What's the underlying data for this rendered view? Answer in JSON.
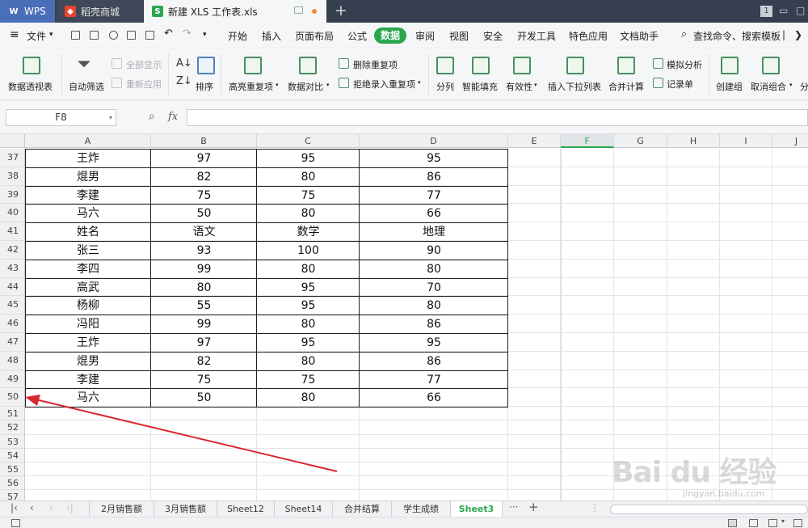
{
  "titlebar": {
    "tabs": [
      {
        "label": "WPS"
      },
      {
        "label": "稻壳商城"
      },
      {
        "label": "新建 XLS 工作表.xls"
      }
    ],
    "new_tab": "+",
    "window_badge": "1"
  },
  "menubar": {
    "file_label": "文件",
    "items": [
      "开始",
      "插入",
      "页面布局",
      "公式",
      "数据",
      "审阅",
      "视图",
      "安全",
      "开发工具",
      "特色应用",
      "文档助手"
    ],
    "active_item": "数据",
    "search_label": "查找命令、搜索模板"
  },
  "ribbon": {
    "pivot": "数据透视表",
    "auto_filter": "自动筛选",
    "show_all": "全部显示",
    "reapply": "重新应用",
    "sort": "排序",
    "highlight_dup": "高亮重复项",
    "remove_dup": "删除重复项",
    "reject_dup": "拒绝录入重复项",
    "compare": "数据对比",
    "split": "分列",
    "smart_fill": "智能填充",
    "validity": "有效性",
    "dropdown": "插入下拉列表",
    "consolidate": "合并计算",
    "whatif": "模拟分析",
    "record": "记录单",
    "group": "创建组",
    "ungroup": "取消组合",
    "subtotal": "分"
  },
  "formula": {
    "cell_ref": "F8",
    "fx": "fx"
  },
  "grid": {
    "selected_column": "F",
    "columns": [
      "A",
      "B",
      "C",
      "D",
      "E",
      "F",
      "G",
      "H",
      "I",
      "J"
    ],
    "rows": [
      {
        "n": "37",
        "a": "王炸",
        "b": "97",
        "c": "95",
        "d": "95"
      },
      {
        "n": "38",
        "a": "焜男",
        "b": "82",
        "c": "80",
        "d": "86"
      },
      {
        "n": "39",
        "a": "李建",
        "b": "75",
        "c": "75",
        "d": "77"
      },
      {
        "n": "40",
        "a": "马六",
        "b": "50",
        "c": "80",
        "d": "66"
      },
      {
        "n": "41",
        "a": "姓名",
        "b": "语文",
        "c": "数学",
        "d": "地理"
      },
      {
        "n": "42",
        "a": "张三",
        "b": "93",
        "c": "100",
        "d": "90"
      },
      {
        "n": "43",
        "a": "李四",
        "b": "99",
        "c": "80",
        "d": "80"
      },
      {
        "n": "44",
        "a": "高武",
        "b": "80",
        "c": "95",
        "d": "70"
      },
      {
        "n": "45",
        "a": "杨柳",
        "b": "55",
        "c": "95",
        "d": "80"
      },
      {
        "n": "46",
        "a": "冯阳",
        "b": "99",
        "c": "80",
        "d": "86"
      },
      {
        "n": "47",
        "a": "王炸",
        "b": "97",
        "c": "95",
        "d": "95"
      },
      {
        "n": "48",
        "a": "焜男",
        "b": "82",
        "c": "80",
        "d": "86"
      },
      {
        "n": "49",
        "a": "李建",
        "b": "75",
        "c": "75",
        "d": "77"
      },
      {
        "n": "50",
        "a": "马六",
        "b": "50",
        "c": "80",
        "d": "66"
      }
    ],
    "empty_rows": [
      "51",
      "52",
      "53",
      "54",
      "55",
      "56",
      "57"
    ]
  },
  "sheets": {
    "tabs": [
      "2月销售额",
      "3月销售额",
      "Sheet12",
      "Sheet14",
      "合并结算",
      "学生成绩",
      "Sheet3"
    ],
    "active": "Sheet3",
    "more": "···",
    "add": "+"
  },
  "watermark": {
    "brand": "Bai du 经验",
    "url": "jingyan.baidu.com"
  },
  "colors": {
    "accent": "#2aa650",
    "titlebar": "#353f4f",
    "arrow": "#d9282f"
  }
}
